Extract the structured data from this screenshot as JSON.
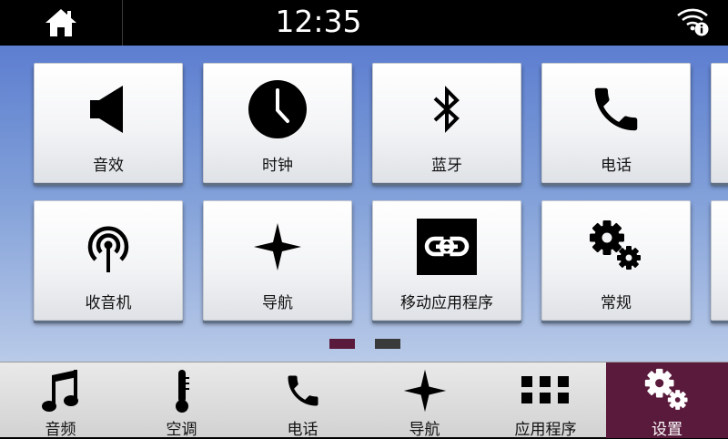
{
  "status_bar": {
    "time": "12:35",
    "home_icon": "home-icon",
    "wifi_icon": "wifi-info-icon"
  },
  "tiles": [
    {
      "label": "音效",
      "icon": "speaker-icon"
    },
    {
      "label": "时钟",
      "icon": "clock-icon"
    },
    {
      "label": "蓝牙",
      "icon": "bluetooth-icon"
    },
    {
      "label": "电话",
      "icon": "phone-icon"
    },
    {
      "label": "收音机",
      "icon": "radio-icon"
    },
    {
      "label": "导航",
      "icon": "navigation-star-icon"
    },
    {
      "label": "移动应用程序",
      "icon": "link-icon"
    },
    {
      "label": "常规",
      "icon": "gears-icon"
    }
  ],
  "pager": {
    "pages": 2,
    "current": 1,
    "active_color": "#5a1a3c",
    "inactive_color": "#3a3a3a"
  },
  "bottom_nav": {
    "items": [
      {
        "label": "音频",
        "icon": "music-note-icon",
        "active": false
      },
      {
        "label": "空调",
        "icon": "thermometer-icon",
        "active": false
      },
      {
        "label": "电话",
        "icon": "phone-icon",
        "active": false
      },
      {
        "label": "导航",
        "icon": "navigation-star-icon",
        "active": false
      },
      {
        "label": "应用程序",
        "icon": "apps-grid-icon",
        "active": false
      },
      {
        "label": "设置",
        "icon": "settings-gears-icon",
        "active": true
      }
    ],
    "active_color": "#5a1a3c"
  }
}
